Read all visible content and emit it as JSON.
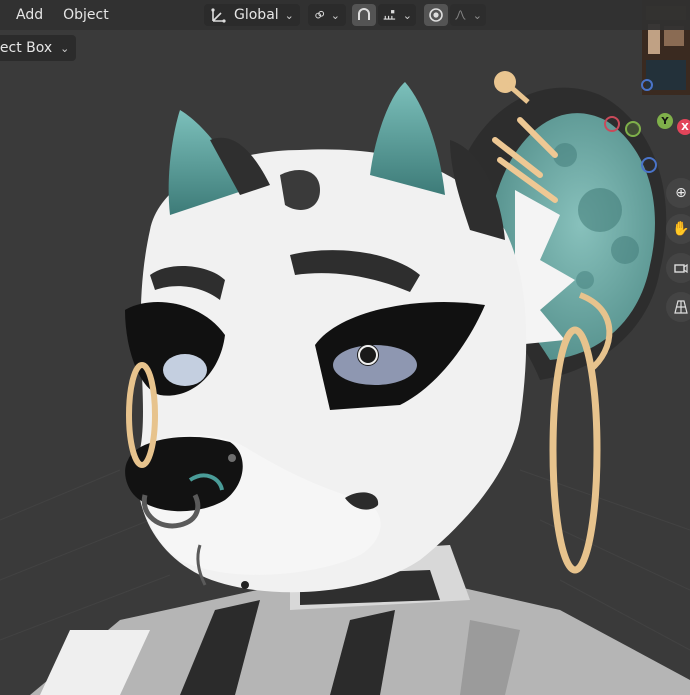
{
  "header": {
    "menu": [
      "Add",
      "Object"
    ],
    "transform_orientation": "Global",
    "selection_mode": "lect Box"
  },
  "gizmo": {
    "y_label": "Y",
    "x_label": "X"
  },
  "colors": {
    "viewport_bg": "#3a3a3a",
    "header_bg": "#303030",
    "fur_white": "#f2f2f2",
    "fur_dark": "#2f2f2f",
    "ear_teal": "#6aa7a3",
    "gold_ring": "#e7c38d",
    "eye_blue": "#8e97b1"
  },
  "icons": {
    "transform_orientation": "transform-orientation-icon",
    "pivot": "pivot-point-icon",
    "snap": "snap-magnet-icon",
    "snap_increment": "snap-increment-icon",
    "proportional": "proportional-editing-icon",
    "falloff": "falloff-curve-icon",
    "zoom": "zoom-plus-icon",
    "pan": "hand-pan-icon",
    "camera": "camera-icon",
    "grid": "grid-perspective-icon"
  }
}
